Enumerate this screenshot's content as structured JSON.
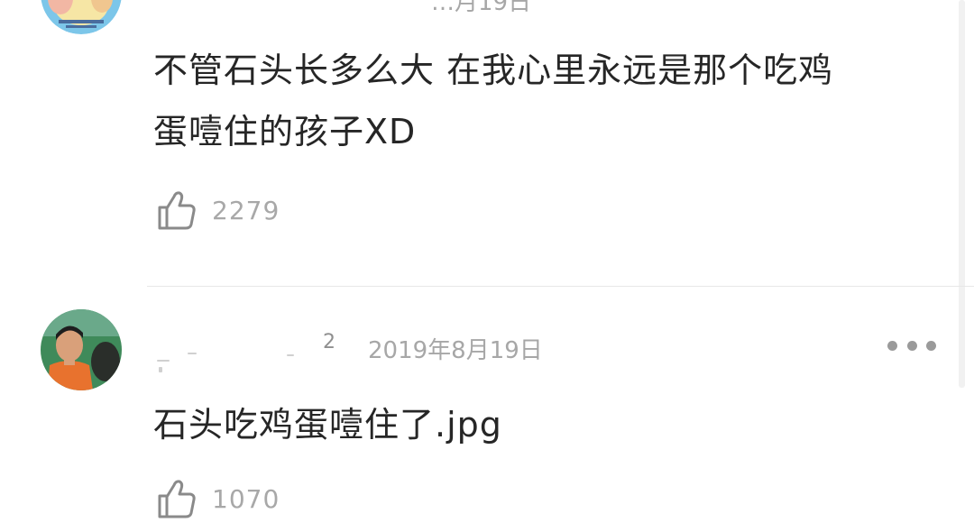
{
  "comments": [
    {
      "date": "…月19日",
      "content_lines": [
        "不管石头长多么大 在我心里永远是那个吃鸡",
        "蛋噎住的孩子XD"
      ],
      "likes": "2279",
      "avatar_icon": "cartoon-avatar"
    },
    {
      "username_visible": "2",
      "date": "2019年8月19日",
      "content_lines": [
        "石头吃鸡蛋噎住了.jpg"
      ],
      "likes": "1070",
      "avatar_icon": "child-photo-avatar",
      "more_icon": "more-dots-icon"
    }
  ],
  "colors": {
    "text": "#262626",
    "muted": "#a7a7a7",
    "divider": "#e7e7e7",
    "background": "#ffffff"
  },
  "icons": {
    "like": "thumbs-up-outline-icon",
    "more": "horizontal-ellipsis-icon"
  }
}
